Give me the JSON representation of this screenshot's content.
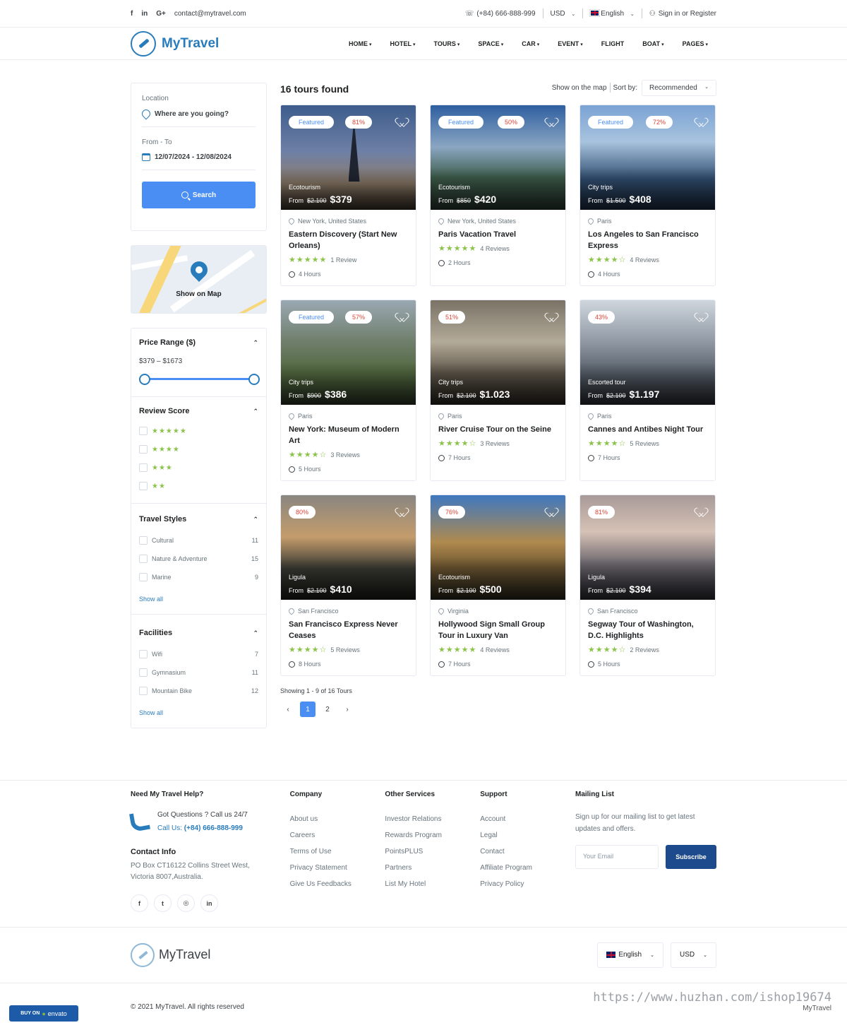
{
  "topbar": {
    "social": [
      "f",
      "in",
      "G+"
    ],
    "email": "contact@mytravel.com",
    "phone": "(+84) 666-888-999",
    "currency": "USD",
    "language": "English",
    "signin": "Sign in or Register"
  },
  "header": {
    "brand": "MyTravel",
    "nav": [
      "HOME",
      "HOTEL",
      "TOURS",
      "SPACE",
      "CAR",
      "EVENT",
      "FLIGHT",
      "BOAT",
      "PAGES"
    ]
  },
  "search": {
    "location_label": "Location",
    "location_placeholder": "Where are you going?",
    "dates_label": "From - To",
    "dates_value": "12/07/2024 - 12/08/2024",
    "button": "Search"
  },
  "map": {
    "label": "Show on Map"
  },
  "filters": {
    "price": {
      "title": "Price Range ($)",
      "range": "$379 – $1673",
      "low": 0,
      "high": 1
    },
    "review": {
      "title": "Review Score",
      "options": [
        "★★★★★",
        "★★★★",
        "★★★",
        "★★"
      ]
    },
    "styles": {
      "title": "Travel Styles",
      "items": [
        {
          "label": "Cultural",
          "count": "11"
        },
        {
          "label": "Nature & Adventure",
          "count": "15"
        },
        {
          "label": "Marine",
          "count": "9"
        }
      ],
      "show_all": "Show all"
    },
    "facilities": {
      "title": "Facilities",
      "items": [
        {
          "label": "Wifi",
          "count": "7"
        },
        {
          "label": "Gymnasium",
          "count": "11"
        },
        {
          "label": "Mountain Bike",
          "count": "12"
        }
      ],
      "show_all": "Show all"
    }
  },
  "results": {
    "count": "16 tours found",
    "show_map": "Show on the map",
    "sort_label": "Sort by:",
    "sort_value": "Recommended",
    "showing": "Showing 1 - 9 of 16 Tours",
    "pages": [
      "‹",
      "1",
      "2",
      "›"
    ]
  },
  "tours": [
    {
      "featured": "Featured",
      "pct": "81%",
      "cat": "Ecotourism",
      "from": "From",
      "old": "$2.100",
      "price": "$379",
      "loc": "New York, United States",
      "title": "Eastern Discovery (Start New Orleans)",
      "stars": "★★★★★",
      "reviews": "1 Review",
      "dur": "4 Hours"
    },
    {
      "featured": "Featured",
      "pct": "50%",
      "cat": "Ecotourism",
      "from": "From",
      "old": "$850",
      "price": "$420",
      "loc": "New York, United States",
      "title": "Paris Vacation Travel",
      "stars": "★★★★★",
      "reviews": "4 Reviews",
      "dur": "2 Hours"
    },
    {
      "featured": "Featured",
      "pct": "72%",
      "cat": "City trips",
      "from": "From",
      "old": "$1.500",
      "price": "$408",
      "loc": "Paris",
      "title": "Los Angeles to San Francisco Express",
      "stars": "★★★★☆",
      "reviews": "4 Reviews",
      "dur": "4 Hours"
    },
    {
      "featured": "Featured",
      "pct": "57%",
      "cat": "City trips",
      "from": "From",
      "old": "$900",
      "price": "$386",
      "loc": "Paris",
      "title": "New York: Museum of Modern Art",
      "stars": "★★★★☆",
      "reviews": "3 Reviews",
      "dur": "5 Hours"
    },
    {
      "featured": "",
      "pct": "51%",
      "cat": "City trips",
      "from": "From",
      "old": "$2.100",
      "price": "$1.023",
      "loc": "Paris",
      "title": "River Cruise Tour on the Seine",
      "stars": "★★★★☆",
      "reviews": "3 Reviews",
      "dur": "7 Hours"
    },
    {
      "featured": "",
      "pct": "43%",
      "cat": "Escorted tour",
      "from": "From",
      "old": "$2.100",
      "price": "$1.197",
      "loc": "Paris",
      "title": "Cannes and Antibes Night Tour",
      "stars": "★★★★☆",
      "reviews": "5 Reviews",
      "dur": "7 Hours"
    },
    {
      "featured": "",
      "pct": "80%",
      "cat": "Ligula",
      "from": "From",
      "old": "$2.100",
      "price": "$410",
      "loc": "San Francisco",
      "title": "San Francisco Express Never Ceases",
      "stars": "★★★★☆",
      "reviews": "5 Reviews",
      "dur": "8 Hours"
    },
    {
      "featured": "",
      "pct": "76%",
      "cat": "Ecotourism",
      "from": "From",
      "old": "$2.100",
      "price": "$500",
      "loc": "Virginia",
      "title": "Hollywood Sign Small Group Tour in Luxury Van",
      "stars": "★★★★★",
      "reviews": "4 Reviews",
      "dur": "7 Hours"
    },
    {
      "featured": "",
      "pct": "81%",
      "cat": "Ligula",
      "from": "From",
      "old": "$2.100",
      "price": "$394",
      "loc": "San Francisco",
      "title": "Segway Tour of Washington, D.C. Highlights",
      "stars": "★★★★☆",
      "reviews": "2 Reviews",
      "dur": "5 Hours"
    }
  ],
  "footer": {
    "help": {
      "title": "Need My Travel Help?",
      "question": "Got Questions ? Call us 24/7",
      "call_prefix": "Call Us: ",
      "call_number": "(+84) 666-888-999",
      "contact_title": "Contact Info",
      "address": "PO Box CT16122 Collins Street West, Victoria 8007,Australia.",
      "socials": [
        "f",
        "t",
        "◎",
        "in"
      ]
    },
    "company": {
      "title": "Company",
      "links": [
        "About us",
        "Careers",
        "Terms of Use",
        "Privacy Statement",
        "Give Us Feedbacks"
      ]
    },
    "services": {
      "title": "Other Services",
      "links": [
        "Investor Relations",
        "Rewards Program",
        "PointsPLUS",
        "Partners",
        "List My Hotel"
      ]
    },
    "support": {
      "title": "Support",
      "links": [
        "Account",
        "Legal",
        "Contact",
        "Affiliate Program",
        "Privacy Policy"
      ]
    },
    "mailing": {
      "title": "Mailing List",
      "text": "Sign up for our mailing list to get latest updates and offers.",
      "placeholder": "Your Email",
      "button": "Subscribe"
    },
    "brand": "MyTravel",
    "language": "English",
    "currency": "USD",
    "copyright": "© 2021 MyTravel. All rights reserved",
    "envato_prefix": "BUY ON",
    "envato": "envato",
    "watermark": "https://www.huzhan.com/ishop19674",
    "watermark_sub": "MyTravel"
  },
  "colors": {
    "primary": "#297cbb",
    "button": "#4a8ef3",
    "star": "#8bc34a",
    "discount": "#de4437",
    "subscribe": "#1d4a8c"
  }
}
